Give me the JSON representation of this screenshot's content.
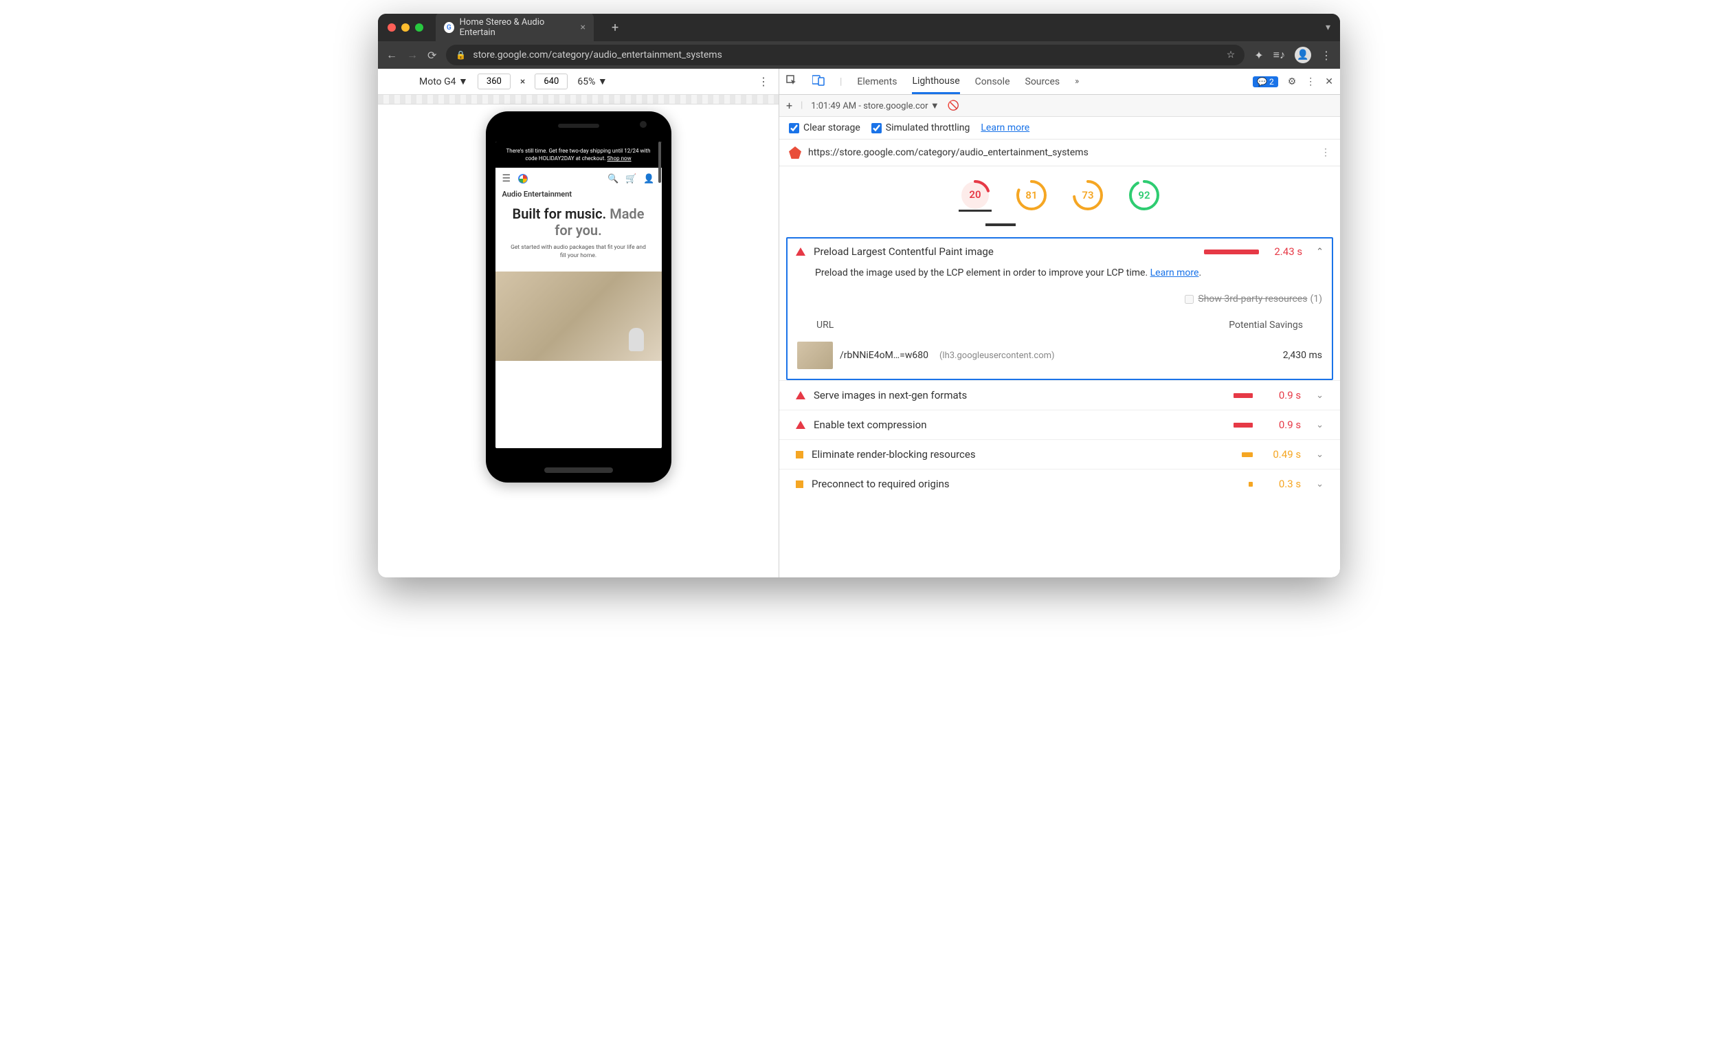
{
  "browser": {
    "tab_title": "Home Stereo & Audio Entertain",
    "url_display": "store.google.com/category/audio_entertainment_systems"
  },
  "device_toolbar": {
    "device": "Moto G4",
    "width": "360",
    "height": "640",
    "zoom": "65%"
  },
  "phone_page": {
    "banner_text": "There's still time. Get free two-day shipping until 12/24 with code HOLIDAY2DAY at checkout.",
    "banner_link": "Shop now",
    "page_heading": "Audio Entertainment",
    "hero_line1": "Built for music.",
    "hero_line2": "Made for you.",
    "hero_sub": "Get started with audio packages that fit your life and fill your home."
  },
  "devtools": {
    "tabs": {
      "elements": "Elements",
      "lighthouse": "Lighthouse",
      "console": "Console",
      "sources": "Sources"
    },
    "messages_count": "2",
    "subbar": {
      "timestamp": "1:01:49 AM - store.google.cor"
    },
    "options": {
      "clear_storage": "Clear storage",
      "simulated_throttling": "Simulated throttling",
      "learn_more": "Learn more"
    },
    "audited_url": "https://store.google.com/category/audio_entertainment_systems",
    "gauges": [
      {
        "score": "20",
        "color": "#e63946",
        "dash": "20 100",
        "bg": "#fdecea"
      },
      {
        "score": "81",
        "color": "#f5a623",
        "dash": "81 100",
        "bg": "#fff"
      },
      {
        "score": "73",
        "color": "#f5a623",
        "dash": "73 100",
        "bg": "#fff"
      },
      {
        "score": "92",
        "color": "#2ecc71",
        "dash": "92 100",
        "bg": "#fff"
      }
    ],
    "main_audit": {
      "title": "Preload Largest Contentful Paint image",
      "value": "2.43 s",
      "description": "Preload the image used by the LCP element in order to improve your LCP time.",
      "learn_more": "Learn more",
      "third_party_label": "Show 3rd-party resources",
      "third_party_count": "(1)",
      "table": {
        "col_url": "URL",
        "col_savings": "Potential Savings",
        "row_path": "/rbNNiE4oM…=w680",
        "row_host": "(lh3.googleusercontent.com)",
        "row_savings": "2,430 ms"
      }
    },
    "opportunities": [
      {
        "icon": "tri-red",
        "title": "Serve images in next-gen formats",
        "bar": "short red",
        "value": "0.9 s",
        "color": "red"
      },
      {
        "icon": "tri-red",
        "title": "Enable text compression",
        "bar": "short red",
        "value": "0.9 s",
        "color": "red"
      },
      {
        "icon": "sq-orange",
        "title": "Eliminate render-blocking resources",
        "bar": "orange",
        "value": "0.49 s",
        "color": "orange"
      },
      {
        "icon": "sq-orange",
        "title": "Preconnect to required origins",
        "bar": "tiny orange",
        "value": "0.3 s",
        "color": "orange"
      }
    ]
  }
}
